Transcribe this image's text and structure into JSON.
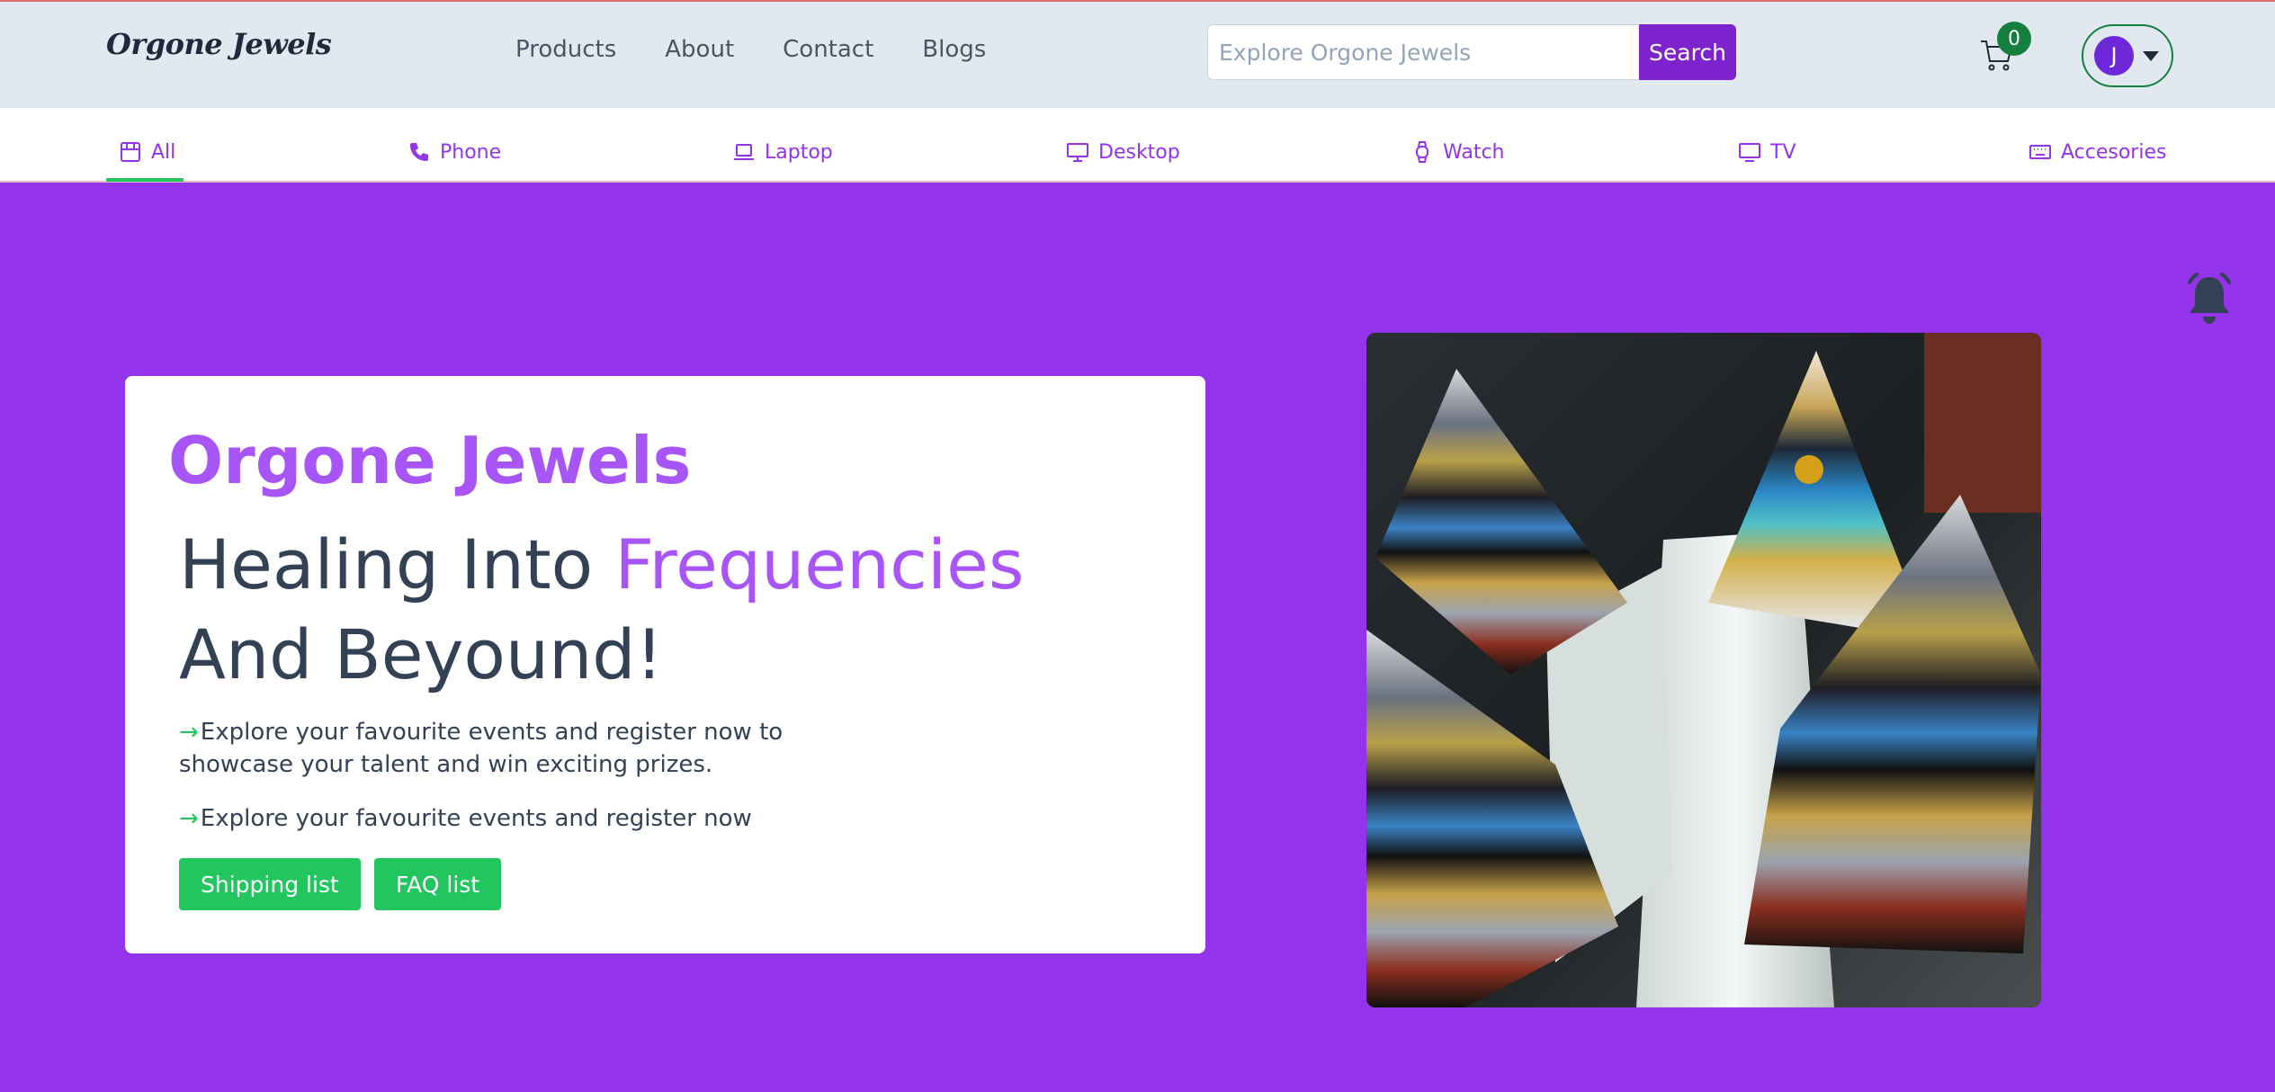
{
  "header": {
    "logo": "Orgone Jewels",
    "nav": [
      "Products",
      "About",
      "Contact",
      "Blogs"
    ],
    "search_placeholder": "Explore Orgone Jewels",
    "search_button": "Search",
    "cart_count": "0",
    "avatar_initial": "J"
  },
  "categories": [
    {
      "label": "All",
      "icon": "store-icon",
      "active": true
    },
    {
      "label": "Phone",
      "icon": "phone-icon"
    },
    {
      "label": "Laptop",
      "icon": "laptop-icon"
    },
    {
      "label": "Desktop",
      "icon": "desktop-icon"
    },
    {
      "label": "Watch",
      "icon": "watch-icon"
    },
    {
      "label": "TV",
      "icon": "tv-icon"
    },
    {
      "label": "Accesories",
      "icon": "keyboard-icon"
    }
  ],
  "hero": {
    "brand": "Orgone Jewels",
    "headline_part1": "Healing Into ",
    "headline_accent": "Frequencies",
    "headline_part2": " And Beyound!",
    "bullet1": "Explore your favourite events and register now to showcase your talent and win exciting prizes.",
    "bullet2": "Explore your favourite events and register now",
    "button_shipping": "Shipping list",
    "button_faq": "FAQ list"
  },
  "colors": {
    "accent": "#9333ea",
    "brand_purple": "#a855f7",
    "green": "#22c55e",
    "search_button": "#7e22ce"
  }
}
